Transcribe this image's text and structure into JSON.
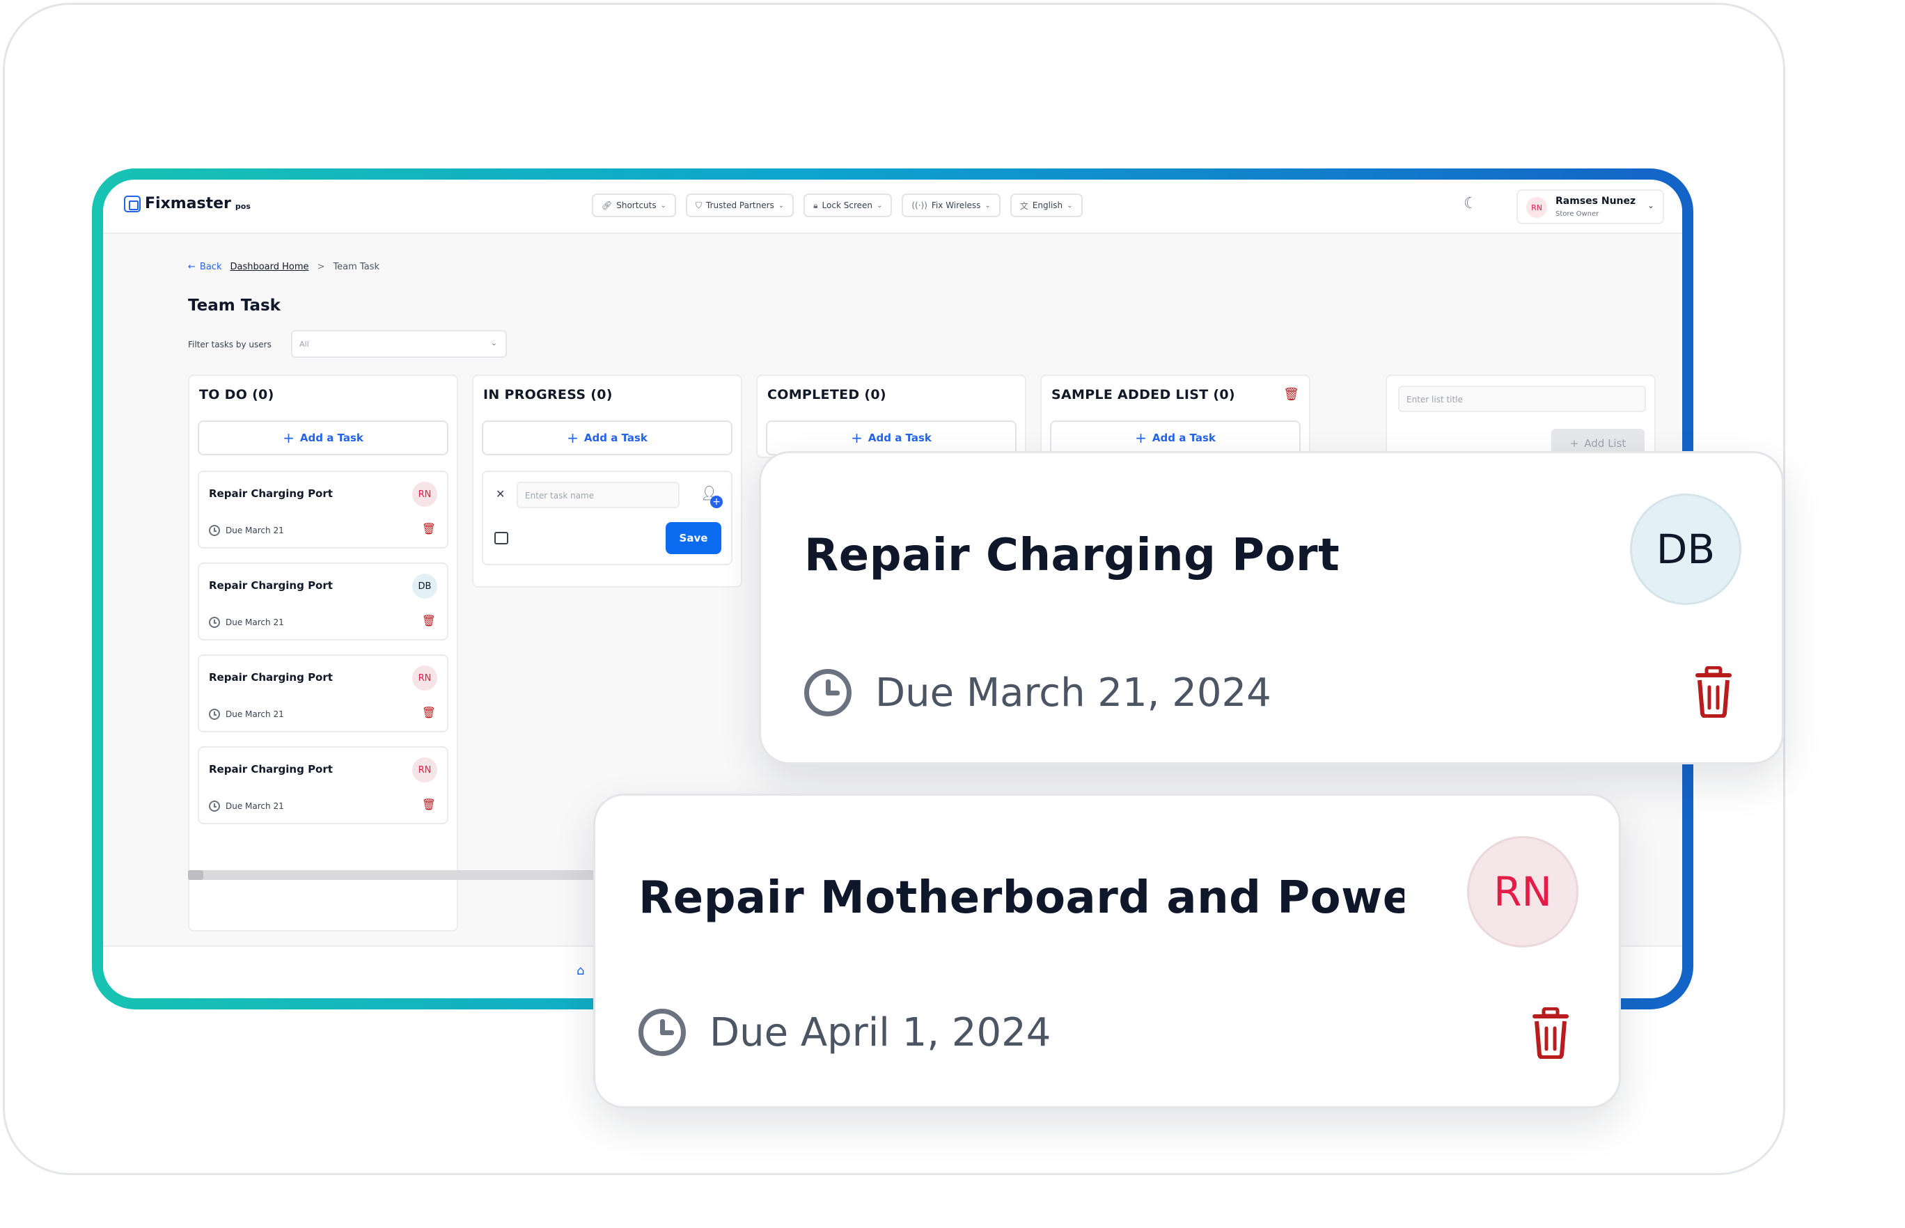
{
  "app": {
    "logo_name": "Fixmaster",
    "logo_suffix": "pos"
  },
  "topbar": {
    "nav": [
      {
        "label": "Shortcuts",
        "icon": "link-icon"
      },
      {
        "label": "Trusted Partners",
        "icon": "shield-icon"
      },
      {
        "label": "Lock Screen",
        "icon": "lock-icon"
      },
      {
        "label": "Fix Wireless",
        "icon": "wireless-icon"
      },
      {
        "label": "English",
        "icon": "translate-icon"
      }
    ],
    "user": {
      "initials": "RN",
      "name": "Ramses Nunez",
      "role": "Store Owner"
    }
  },
  "breadcrumb": {
    "back": "Back",
    "home": "Dashboard Home",
    "separator": ">",
    "current": "Team Task"
  },
  "page": {
    "title": "Team Task",
    "filter_label": "Filter tasks by users",
    "filter_value": "All"
  },
  "columns": [
    {
      "title": "TO DO (0)",
      "add_label": "Add a Task",
      "cards": [
        {
          "title": "Repair Charging Port",
          "assignee": "RN",
          "due": "Due March 21"
        },
        {
          "title": "Repair Charging Port",
          "assignee": "DB",
          "due": "Due March 21"
        },
        {
          "title": "Repair Charging Port",
          "assignee": "RN",
          "due": "Due March 21"
        },
        {
          "title": "Repair Charging Port",
          "assignee": "RN",
          "due": "Due March 21"
        }
      ]
    },
    {
      "title": "IN PROGRESS (0)",
      "add_label": "Add a Task",
      "new_task": {
        "placeholder": "Enter task name",
        "save_label": "Save"
      }
    },
    {
      "title": "COMPLETED (0)",
      "add_label": "Add a Task"
    },
    {
      "title": "SAMPLE ADDED LIST (0)",
      "add_label": "Add a Task"
    }
  ],
  "new_list": {
    "placeholder": "Enter list title",
    "button_label": "Add List"
  },
  "zoom_cards": [
    {
      "title": "Repair Charging Port",
      "assignee": "DB",
      "due": "Due March 21, 2024"
    },
    {
      "title": "Repair Motherboard and Power B...",
      "assignee": "RN",
      "due": "Due April 1, 2024"
    }
  ],
  "colors": {
    "accent": "#2563eb",
    "save_button": "#0b6cf2",
    "delete": "#b91c1c",
    "avatar_rn": "#e11d48",
    "frame_gradient": [
      "#17c3b2",
      "#1463c8"
    ]
  }
}
